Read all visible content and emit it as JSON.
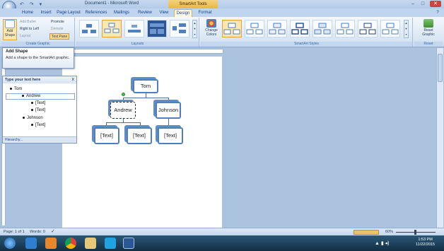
{
  "window": {
    "document_title": "Document1 - Microsoft Word",
    "context_title": "SmartArt Tools",
    "minimize": "–",
    "maximize": "□",
    "close": "✕"
  },
  "tabs": [
    "Home",
    "Insert",
    "Page Layout",
    "References",
    "Mailings",
    "Review",
    "View",
    "Design",
    "Format"
  ],
  "active_tab": "Design",
  "ribbon": {
    "create_graphic": {
      "label": "Create Graphic",
      "add_shape": "Add Shape",
      "add_bullet": "Add Bullet",
      "right_to_left": "Right to Left",
      "layout": "Layout",
      "promote": "Promote",
      "demote": "Demote",
      "text_pane": "Text Pane"
    },
    "layouts": {
      "label": "Layouts"
    },
    "styles": {
      "label": "SmartArt Styles",
      "change_colors": "Change Colors"
    },
    "reset": {
      "label": "Reset",
      "reset_graphic": "Reset Graphic"
    }
  },
  "tooltip": {
    "title": "Add Shape",
    "body": "Add a shape to the SmartArt graphic."
  },
  "text_pane": {
    "title": "Type your text here",
    "close": "x",
    "items": [
      {
        "text": "Tom"
      },
      {
        "text": "Andrew"
      },
      {
        "text": "[Text]"
      },
      {
        "text": "[Text]"
      },
      {
        "text": "Johnson"
      },
      {
        "text": "[Text]"
      }
    ],
    "footer": "Hierarchy..."
  },
  "smartart": {
    "root": "Tom",
    "level2": [
      "Andrew",
      "Johnson"
    ],
    "level3": [
      "[Text]",
      "[Text]",
      "[Text]"
    ]
  },
  "status": {
    "page": "Page: 1 of 1",
    "words": "Words: 0",
    "zoom": "60%"
  },
  "taskbar": {
    "time": "1:53 PM",
    "date": "11/22/2015"
  }
}
